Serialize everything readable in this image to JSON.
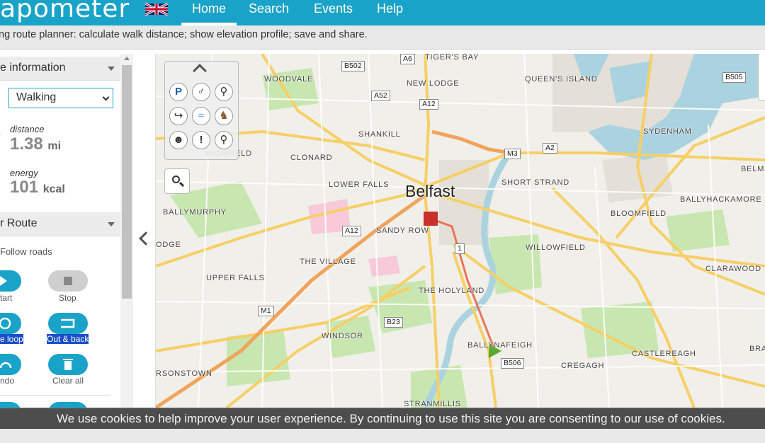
{
  "header": {
    "logo_text": "apometer",
    "nav": {
      "home": "Home",
      "search": "Search",
      "events": "Events",
      "help": "Help"
    },
    "subtitle": "ng route planner: calculate walk distance; show elevation profile; save and share."
  },
  "panel": {
    "info_heading": "e information",
    "activity": "Walking",
    "distance": {
      "label": "distance",
      "value": "1.38",
      "unit": "mi"
    },
    "energy": {
      "label": "energy",
      "value": "101",
      "unit": "kcal"
    },
    "route_heading": "r Route",
    "follow_roads": "Follow roads",
    "buttons": {
      "start": "tart",
      "stop": "Stop",
      "loop": "e loop",
      "out_back": "Out & back",
      "undo": "ndo",
      "clear_all": "Clear all"
    }
  },
  "map": {
    "city": "Belfast",
    "places": {
      "tigers_bay": "TIGER'S BAY",
      "woodvale": "WOODVALE",
      "new_lodge": "NEW LODGE",
      "queens_island": "QUEEN'S ISLAND",
      "shankill": "SHANKILL",
      "sydenham": "SYDENHAM",
      "highfield": "HIGHFIELD",
      "clonard": "CLONARD",
      "lower_falls": "LOWER FALLS",
      "short_strand": "SHORT STRAND",
      "belmont": "BELM",
      "ballymurphy": "BALLYMURPHY",
      "ballyhackamore": "BALLYHACKAMORE",
      "bloomfield": "BLOOMFIELD",
      "sandy_row": "SANDY ROW",
      "lodge": "ODGE",
      "willowfield": "WILLOWFIELD",
      "the_village": "THE VILLAGE",
      "clarawood": "CLARAWOOD",
      "upper_falls": "UPPER FALLS",
      "the_holyland": "THE HOLYLAND",
      "windsor": "WINDSOR",
      "ballynafeigh": "BALLYNAFEIGH",
      "castlereagh": "CASTLEREAGH",
      "bran": "BRAN",
      "cregagh": "CREGAGH",
      "rsonstown": "RSONSTOWN",
      "stranmillis": "STRANMILLIS"
    },
    "roads": {
      "a6": "A6",
      "b502": "B502",
      "b505": "B505",
      "a52": "A52",
      "a12_n": "A12",
      "m3": "M3",
      "a2": "A2",
      "a12_w": "A12",
      "r1": "1",
      "m1": "M1",
      "b23": "B23",
      "b506": "B506"
    },
    "colors": {
      "route": "#e8735a",
      "start_marker": "#c9302c",
      "end_marker": "#5aa832",
      "water": "#aad3df",
      "park": "#c8e6b0"
    }
  },
  "cookie_notice": "We use cookies to help improve your user experience. By continuing to use this site you are consenting to our use of cookies."
}
